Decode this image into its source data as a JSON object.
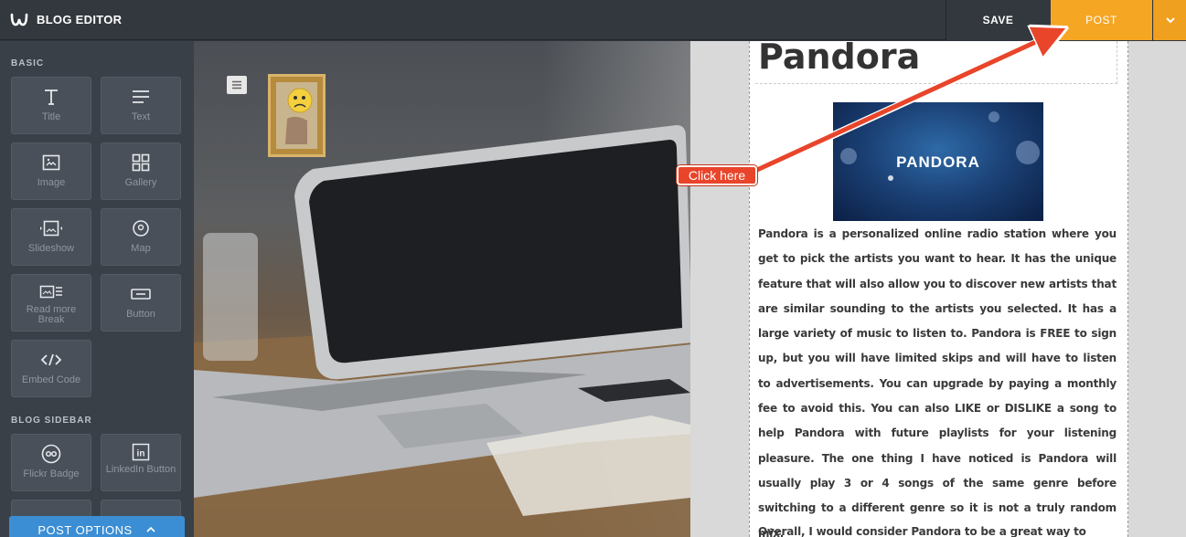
{
  "app": {
    "title": "BLOG EDITOR"
  },
  "toolbar": {
    "save_label": "SAVE",
    "post_label": "POST",
    "dropdown_icon": "chevron-down-icon"
  },
  "sidebar": {
    "basic_label": "BASIC",
    "basic_items": [
      {
        "label": "Title",
        "icon": "title-icon"
      },
      {
        "label": "Text",
        "icon": "text-icon"
      },
      {
        "label": "Image",
        "icon": "image-icon"
      },
      {
        "label": "Gallery",
        "icon": "gallery-icon"
      },
      {
        "label": "Slideshow",
        "icon": "slideshow-icon"
      },
      {
        "label": "Map",
        "icon": "map-icon"
      },
      {
        "label": "Read more Break",
        "icon": "read-more-icon"
      },
      {
        "label": "Button",
        "icon": "button-icon"
      },
      {
        "label": "Embed Code",
        "icon": "embed-code-icon"
      }
    ],
    "blog_sidebar_label": "BLOG SIDEBAR",
    "blog_items": [
      {
        "label": "Flickr Badge",
        "icon": "flickr-icon"
      },
      {
        "label": "LinkedIn Button",
        "icon": "linkedin-icon"
      }
    ],
    "post_options_label": "POST OPTIONS"
  },
  "post": {
    "title": "Pandora",
    "image_text": "PANDORA",
    "body": "Pandora is a personalized online radio station where you get to pick the artists you want to hear.  It has the unique feature that will also allow you to discover new artists that are similar sounding to the artists you selected. It has a large variety of music to listen to.  Pandora is FREE to sign up, but you will have limited skips and will have to listen to advertisements.  You can upgrade by paying a monthly fee to avoid this.  You can also LIKE or DISLIKE a song to help Pandora with future playlists for your listening pleasure.  The one thing I have noticed is Pandora will usually play 3 or 4 songs of the same genre before switching to a different genre so it is not a truly random mix.",
    "body2": "Overall, I would consider Pandora to be a great way to listen to"
  },
  "annotation": {
    "callout_text": "Click here"
  },
  "colors": {
    "post_button": "#f5a623",
    "post_options": "#3b8ed4",
    "callout": "#e8452b"
  }
}
